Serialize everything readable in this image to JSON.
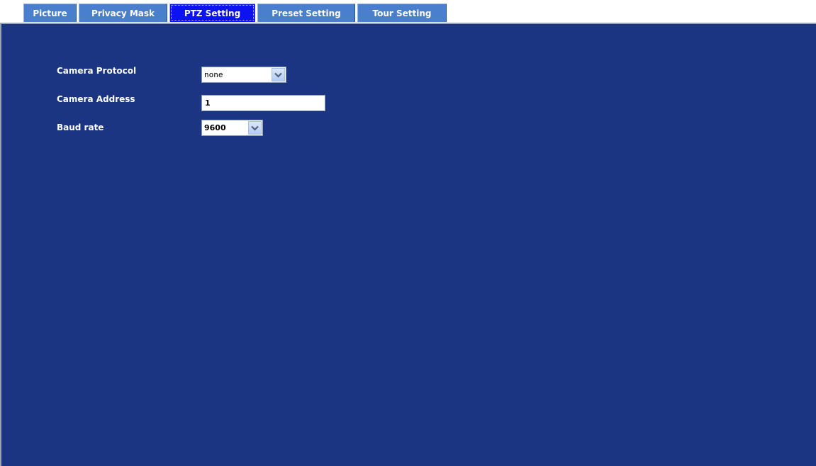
{
  "tabs": [
    {
      "label": "Picture",
      "active": false
    },
    {
      "label": "Privacy Mask",
      "active": false
    },
    {
      "label": "PTZ Setting",
      "active": true
    },
    {
      "label": "Preset Setting",
      "active": false
    },
    {
      "label": "Tour Setting",
      "active": false
    }
  ],
  "form": {
    "camera_protocol": {
      "label": "Camera Protocol",
      "value": "none"
    },
    "camera_address": {
      "label": "Camera Address",
      "value": "1"
    },
    "baud_rate": {
      "label": "Baud rate",
      "value": "9600"
    }
  },
  "icons": {
    "dropdown": "chevron-down-icon"
  },
  "colors": {
    "panel_bg": "#1b3583",
    "tab_bg": "#4a7fcd",
    "tab_active_bg": "#0c12f0",
    "text": "#ffffff"
  }
}
